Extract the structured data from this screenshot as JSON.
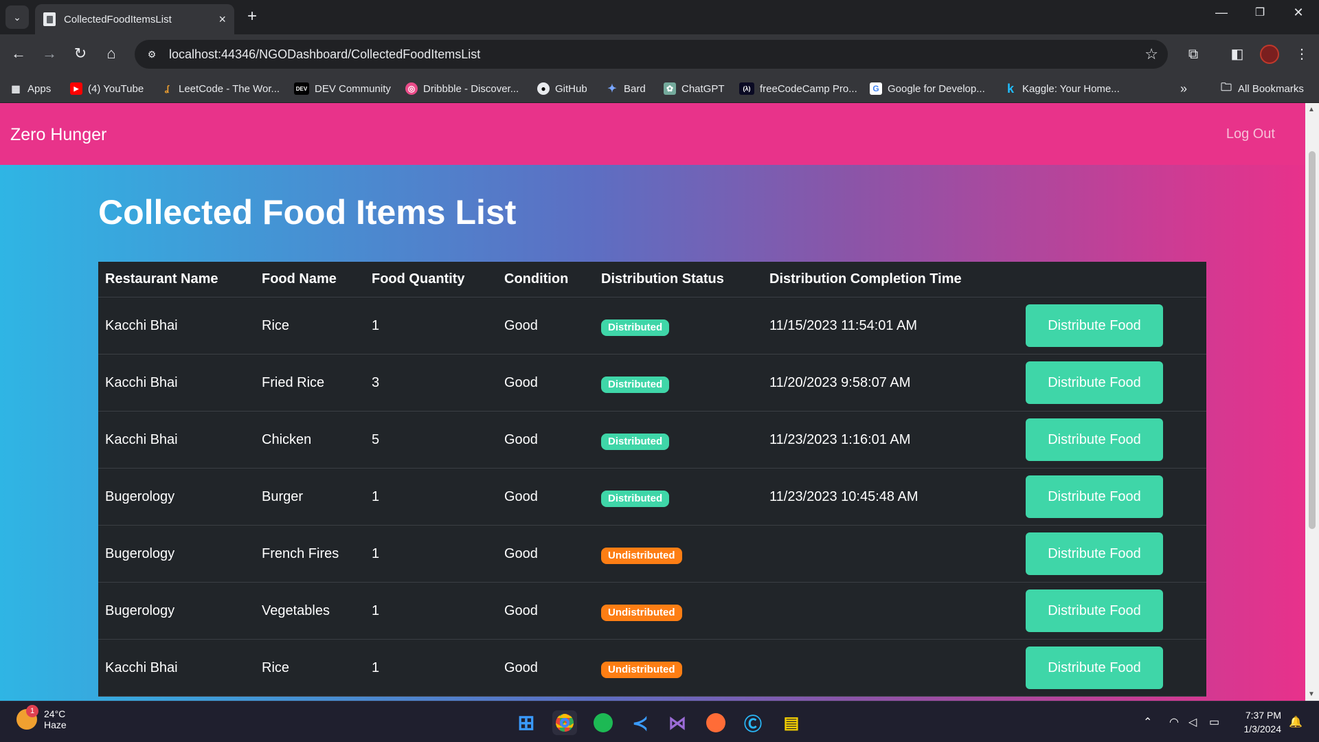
{
  "browser": {
    "tab_title": "CollectedFoodItemsList",
    "url": "localhost:44346/NGODashboard/CollectedFoodItemsList",
    "bookmarks": [
      {
        "label": "Apps",
        "icon": "apps-grid-icon"
      },
      {
        "label": "(4) YouTube",
        "icon": "youtube-icon"
      },
      {
        "label": "LeetCode - The Wor...",
        "icon": "leetcode-icon"
      },
      {
        "label": "DEV Community",
        "icon": "dev-icon"
      },
      {
        "label": "Dribbble - Discover...",
        "icon": "dribbble-icon"
      },
      {
        "label": "GitHub",
        "icon": "github-icon"
      },
      {
        "label": "Bard",
        "icon": "bard-icon"
      },
      {
        "label": "ChatGPT",
        "icon": "chatgpt-icon"
      },
      {
        "label": "freeCodeCamp Pro...",
        "icon": "freecodecamp-icon"
      },
      {
        "label": "Google for Develop...",
        "icon": "google-icon"
      },
      {
        "label": "Kaggle: Your Home...",
        "icon": "kaggle-icon"
      }
    ],
    "all_bookmarks": "All Bookmarks",
    "dev_icon_text": "DEV",
    "freecodecamp_icon_text": "(λ)",
    "google_icon_text": "G",
    "kaggle_icon_text": "k"
  },
  "navbar": {
    "brand": "Zero Hunger",
    "logout": "Log Out"
  },
  "main": {
    "heading": "Collected Food Items List",
    "columns": [
      "Restaurant Name",
      "Food Name",
      "Food Quantity",
      "Condition",
      "Distribution Status",
      "Distribution Completion Time"
    ],
    "rows": [
      {
        "restaurant": "Kacchi Bhai",
        "food": "Rice",
        "qty": "1",
        "condition": "Good",
        "status": "Distributed",
        "time": "11/15/2023 11:54:01 AM",
        "action": "Distribute Food"
      },
      {
        "restaurant": "Kacchi Bhai",
        "food": "Fried Rice",
        "qty": "3",
        "condition": "Good",
        "status": "Distributed",
        "time": "11/20/2023 9:58:07 AM",
        "action": "Distribute Food"
      },
      {
        "restaurant": "Kacchi Bhai",
        "food": "Chicken",
        "qty": "5",
        "condition": "Good",
        "status": "Distributed",
        "time": "11/23/2023 1:16:01 AM",
        "action": "Distribute Food"
      },
      {
        "restaurant": "Bugerology",
        "food": "Burger",
        "qty": "1",
        "condition": "Good",
        "status": "Distributed",
        "time": "11/23/2023 10:45:48 AM",
        "action": "Distribute Food"
      },
      {
        "restaurant": "Bugerology",
        "food": "French Fires",
        "qty": "1",
        "condition": "Good",
        "status": "Undistributed",
        "time": "",
        "action": "Distribute Food"
      },
      {
        "restaurant": "Bugerology",
        "food": "Vegetables",
        "qty": "1",
        "condition": "Good",
        "status": "Undistributed",
        "time": "",
        "action": "Distribute Food"
      },
      {
        "restaurant": "Kacchi Bhai",
        "food": "Rice",
        "qty": "1",
        "condition": "Good",
        "status": "Undistributed",
        "time": "",
        "action": "Distribute Food"
      }
    ]
  },
  "colors": {
    "navbar": "#e8338a",
    "distributed": "#3fd6a8",
    "undistributed": "#fd7e14",
    "button": "#3fd6a8",
    "table": "#212529"
  },
  "taskbar": {
    "temperature": "24°C",
    "weather": "Haze",
    "weather_badge": "1",
    "time": "7:37 PM",
    "date": "1/3/2024",
    "apps": [
      "windows-start-icon",
      "chrome-icon",
      "spotify-icon",
      "vscode-icon",
      "visual-studio-icon",
      "postman-icon",
      "c-app-icon",
      "file-app-icon"
    ]
  }
}
